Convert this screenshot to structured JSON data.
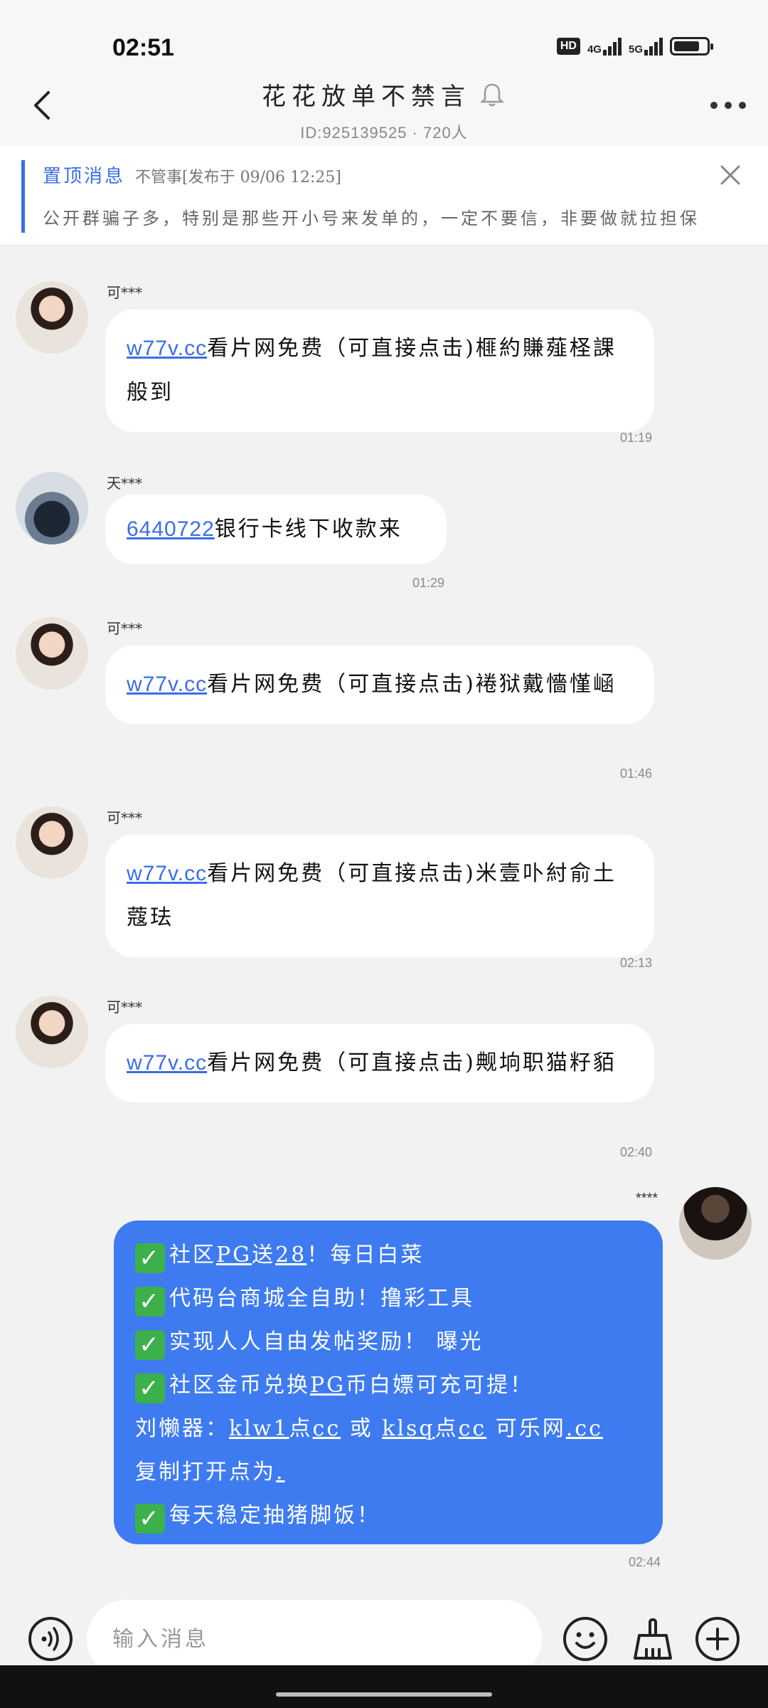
{
  "status_bar": {
    "time": "02:51",
    "hd": "HD",
    "net1": "4G",
    "net2": "5G",
    "battery_level": 0.8
  },
  "header": {
    "title": "花花放单不禁言",
    "subtitle": "ID:925139525 · 720人"
  },
  "pinned": {
    "label": "置顶消息",
    "meta": "不管事[发布于 09/06 12:25]",
    "text": "公开群骗子多，特别是那些开小号来发单的，一定不要信，非要做就拉担保"
  },
  "messages": [
    {
      "sender": "可***",
      "link": "w77v.cc",
      "text": "看片网免费（可直接点击)榧約賺薤柽課般到",
      "time": "01:19"
    },
    {
      "sender": "天***",
      "link": "6440722",
      "text": "银行卡线下收款来",
      "time": "01:29"
    },
    {
      "sender": "可***",
      "link": "w77v.cc",
      "text": "看片网免费（可直接点击)裷狱戴懎慬崡",
      "time": "01:46"
    },
    {
      "sender": "可***",
      "link": "w77v.cc",
      "text": "看片网免费（可直接点击)米壹卟紂俞土蔻珐",
      "time": "02:13"
    },
    {
      "sender": "可***",
      "link": "w77v.cc",
      "text": "看片网免费（可直接点击)觍垧职猫籽貊",
      "time": "02:40"
    }
  ],
  "self_message": {
    "sender": "****",
    "time": "02:44",
    "line1_a": "社区",
    "line1_b": "PG",
    "line1_c": "送",
    "line1_d": "28",
    "line1_e": "！每日白菜",
    "line2": "代码台商城全自助！撸彩工具",
    "line3": "实现人人自由发帖奖励！ 曝光",
    "line4_a": "社区金币兑换",
    "line4_b": "PG",
    "line4_c": "币白嫖可充可提！",
    "line5_a": "刘懒器：",
    "line5_b": "klw1",
    "line5_c": "点",
    "line5_d": "cc",
    "line5_e": " 或 ",
    "line5_f": "klsq",
    "line5_g": "点",
    "line5_h": "cc",
    "line5_i": " 可乐网",
    "line5_j": ".cc",
    "line6_a": "复制打开点为",
    "line6_b": ".",
    "line7": "每天稳定抽猪脚饭！"
  },
  "input": {
    "placeholder": "输入消息"
  },
  "icons": {
    "back": "back-arrow-icon",
    "bell": "bell-muted-icon",
    "more": "more-dots-icon",
    "close": "close-icon",
    "voice": "voice-icon",
    "emoji": "emoji-icon",
    "cleaner": "broom-icon",
    "plus": "plus-icon"
  },
  "colors": {
    "accent": "#3a6ee8",
    "self_bubble": "#3e7bf0",
    "check": "#3cb04a"
  }
}
